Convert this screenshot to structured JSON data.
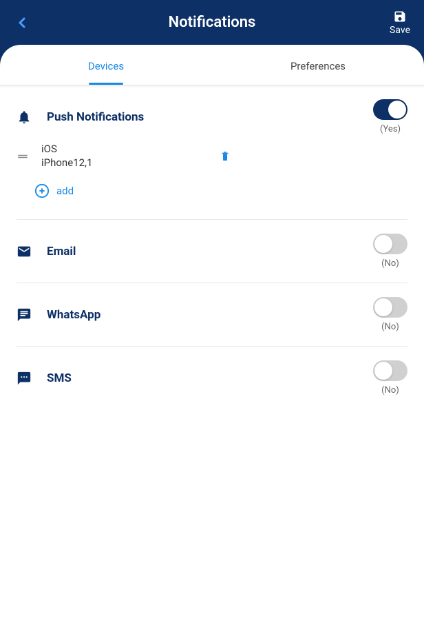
{
  "header": {
    "title": "Notifications",
    "save_label": "Save"
  },
  "tabs": {
    "devices": "Devices",
    "preferences": "Preferences"
  },
  "push": {
    "title": "Push Notifications",
    "toggle_state": "(Yes)",
    "device": {
      "os": "iOS",
      "model": "iPhone12,1"
    },
    "add_label": "add"
  },
  "email": {
    "title": "Email",
    "toggle_state": "(No)"
  },
  "whatsapp": {
    "title": "WhatsApp",
    "toggle_state": "(No)"
  },
  "sms": {
    "title": "SMS",
    "toggle_state": "(No)"
  }
}
